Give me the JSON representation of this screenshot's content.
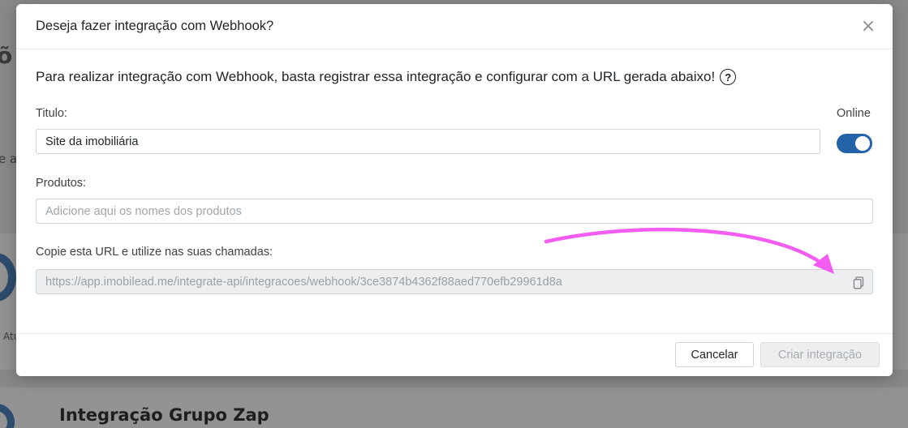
{
  "background": {
    "heading_fragment": "õ",
    "text_fragment": "e a",
    "small_fragment": "Atu",
    "card_title": "Integração Grupo Zap"
  },
  "modal": {
    "title": "Deseja fazer integração com Webhook?",
    "close_symbol": "×",
    "intro_text": "Para realizar integração com Webhook, basta registrar essa integração e configurar com a URL gerada abaixo!",
    "help_symbol": "?",
    "title_label": "Titulo:",
    "title_value": "Site da imobiliária",
    "online_label": "Online",
    "online_enabled": true,
    "products_label": "Produtos:",
    "products_placeholder": "Adicione aqui os nomes dos produtos",
    "url_label": "Copie esta URL e utilize nas suas chamadas:",
    "url_value": "https://app.imobilead.me/integrate-api/integracoes/webhook/3ce3874b4362f88aed770efb29961d8a",
    "cancel_label": "Cancelar",
    "create_label": "Criar integração"
  },
  "icons": {
    "close": "close-icon",
    "help": "help-circle-icon",
    "copy": "copy-icon",
    "annotation": "arrow-annotation"
  },
  "colors": {
    "toggle_on": "#2463a8",
    "annotation_arrow": "#f25cf0"
  }
}
